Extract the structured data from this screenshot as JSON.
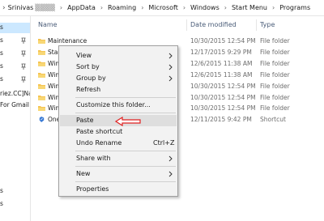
{
  "address_bar": {
    "crumbs": [
      "Srinivas",
      "AppData",
      "Roaming",
      "Microsoft",
      "Windows",
      "Start Menu",
      "Programs"
    ]
  },
  "nav_pane": {
    "items": [
      {
        "label": "s",
        "selected": true
      },
      {
        "label": "s",
        "pinned": true
      },
      {
        "label": "s",
        "pinned": true
      },
      {
        "label": "s",
        "pinned": true
      },
      {
        "label": "s",
        "pinned": true
      },
      {
        "label": "riez.CC]Na",
        "pinned": false
      },
      {
        "label": "For Gmail",
        "pinned": false
      },
      {
        "label": "s",
        "pinned": false
      },
      {
        "label": "s",
        "pinned": false
      }
    ]
  },
  "columns": {
    "name": "Name",
    "date_modified": "Date modified",
    "type": "Type"
  },
  "files": [
    {
      "name": "Maintenance",
      "date": "10/30/2015 12:54 PM",
      "type": "File folder",
      "icon": "folder-icon"
    },
    {
      "name": "Star",
      "date": "12/17/2015 9:29 PM",
      "type": "File folder",
      "icon": "folder-icon"
    },
    {
      "name": "Win",
      "date": "12/6/2015 11:38 AM",
      "type": "File folder",
      "icon": "folder-icon"
    },
    {
      "name": "Win",
      "date": "12/6/2015 11:38 AM",
      "type": "File folder",
      "icon": "folder-icon"
    },
    {
      "name": "Win",
      "date": "10/30/2015 12:54 PM",
      "type": "File folder",
      "icon": "folder-icon"
    },
    {
      "name": "Win",
      "date": "10/30/2015 12:54 PM",
      "type": "File folder",
      "icon": "folder-icon"
    },
    {
      "name": "Win",
      "date": "10/30/2015 12:54 PM",
      "type": "File folder",
      "icon": "folder-icon"
    },
    {
      "name": "One",
      "date": "12/11/2015 9:42 PM",
      "type": "Shortcut",
      "icon": "shortcut-icon"
    }
  ],
  "context_menu": {
    "view": "View",
    "sort_by": "Sort by",
    "group_by": "Group by",
    "refresh": "Refresh",
    "customize": "Customize this folder...",
    "paste": "Paste",
    "paste_shortcut": "Paste shortcut",
    "undo_rename": "Undo Rename",
    "undo_shortcut": "Ctrl+Z",
    "share_with": "Share with",
    "new": "New",
    "properties": "Properties"
  },
  "colors": {
    "folder": "#f5c451",
    "highlight": "#dedede",
    "selection": "#cce8ff",
    "annotation_arrow": "#e02020"
  }
}
